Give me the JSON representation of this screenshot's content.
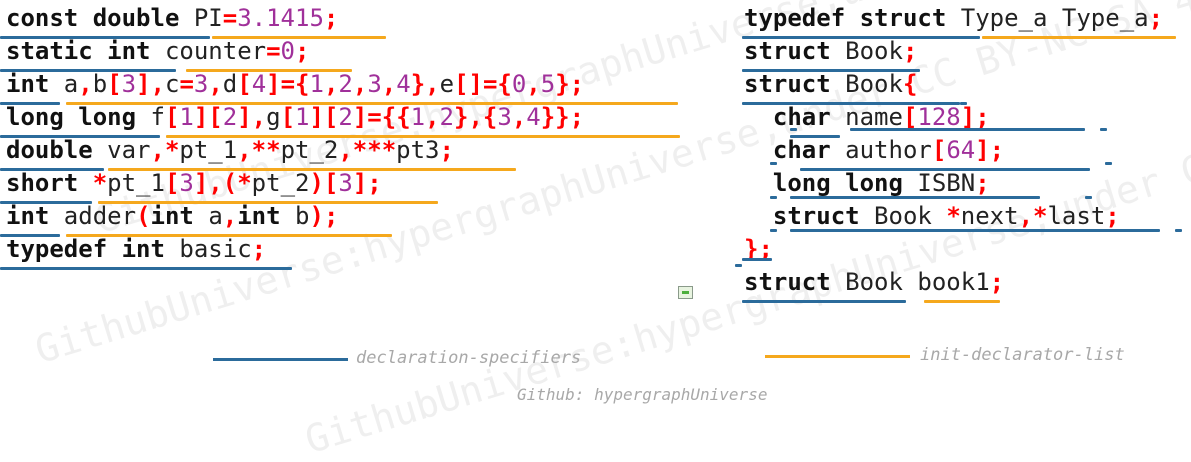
{
  "colors": {
    "keyword": "#111111",
    "identifier": "#222222",
    "punctuation": "#ff0000",
    "number": "#a0309a",
    "declaration_specifiers": "#2b6b9b",
    "init_declarator_list": "#f5a81d",
    "watermark": "#efefef",
    "caption": "#a8a8a8"
  },
  "watermark_text": "GithubUniverse:hypergraphUniverse,under CC BY-NC-SA 4.0",
  "left_code": [
    [
      [
        "k",
        "const double"
      ],
      [
        "t",
        " PI"
      ],
      [
        "p",
        "="
      ],
      [
        "n",
        "3.1415"
      ],
      [
        "p",
        ";"
      ]
    ],
    [
      [
        "k",
        "static int"
      ],
      [
        "t",
        " counter"
      ],
      [
        "p",
        "="
      ],
      [
        "n",
        "0"
      ],
      [
        "p",
        ";"
      ]
    ],
    [
      [
        "k",
        "int"
      ],
      [
        "t",
        " a"
      ],
      [
        "p",
        ","
      ],
      [
        "t",
        "b"
      ],
      [
        "p",
        "["
      ],
      [
        "n",
        "3"
      ],
      [
        "p",
        "],"
      ],
      [
        "t",
        "c"
      ],
      [
        "p",
        "="
      ],
      [
        "n",
        "3"
      ],
      [
        "p",
        ","
      ],
      [
        "t",
        "d"
      ],
      [
        "p",
        "["
      ],
      [
        "n",
        "4"
      ],
      [
        "p",
        "]={"
      ],
      [
        "n",
        "1"
      ],
      [
        "p",
        ","
      ],
      [
        "n",
        "2"
      ],
      [
        "p",
        ","
      ],
      [
        "n",
        "3"
      ],
      [
        "p",
        ","
      ],
      [
        "n",
        "4"
      ],
      [
        "p",
        "},"
      ],
      [
        "t",
        "e"
      ],
      [
        "p",
        "[]={"
      ],
      [
        "n",
        "0"
      ],
      [
        "p",
        ","
      ],
      [
        "n",
        "5"
      ],
      [
        "p",
        "};"
      ]
    ],
    [
      [
        "k",
        "long long"
      ],
      [
        "t",
        " f"
      ],
      [
        "p",
        "["
      ],
      [
        "n",
        "1"
      ],
      [
        "p",
        "]["
      ],
      [
        "n",
        "2"
      ],
      [
        "p",
        "],"
      ],
      [
        "t",
        "g"
      ],
      [
        "p",
        "["
      ],
      [
        "n",
        "1"
      ],
      [
        "p",
        "]["
      ],
      [
        "n",
        "2"
      ],
      [
        "p",
        "]={{"
      ],
      [
        "n",
        "1"
      ],
      [
        "p",
        ","
      ],
      [
        "n",
        "2"
      ],
      [
        "p",
        "},{"
      ],
      [
        "n",
        "3"
      ],
      [
        "p",
        ","
      ],
      [
        "n",
        "4"
      ],
      [
        "p",
        "}};"
      ]
    ],
    [
      [
        "k",
        "double"
      ],
      [
        "t",
        " var"
      ],
      [
        "p",
        ",*"
      ],
      [
        "t",
        "pt_1"
      ],
      [
        "p",
        ",**"
      ],
      [
        "t",
        "pt_2"
      ],
      [
        "p",
        ",***"
      ],
      [
        "t",
        "pt3"
      ],
      [
        "p",
        ";"
      ]
    ],
    [
      [
        "k",
        "short"
      ],
      [
        "t",
        " "
      ],
      [
        "p",
        "*"
      ],
      [
        "t",
        "pt_1"
      ],
      [
        "p",
        "["
      ],
      [
        "n",
        "3"
      ],
      [
        "p",
        "],("
      ],
      [
        "p",
        "*"
      ],
      [
        "t",
        "pt_2"
      ],
      [
        "p",
        ")["
      ],
      [
        "n",
        "3"
      ],
      [
        "p",
        "];"
      ]
    ],
    [
      [
        "k",
        "int"
      ],
      [
        "t",
        " adder"
      ],
      [
        "p",
        "("
      ],
      [
        "k",
        "int"
      ],
      [
        "t",
        " a"
      ],
      [
        "p",
        ","
      ],
      [
        "k",
        "int"
      ],
      [
        "t",
        " b"
      ],
      [
        "p",
        ");"
      ]
    ],
    [
      [
        "k",
        "typedef int"
      ],
      [
        "t",
        " basic"
      ],
      [
        "p",
        ";"
      ]
    ]
  ],
  "right_code": [
    [
      [
        "k",
        "typedef struct"
      ],
      [
        "t",
        " Type_a Type_a"
      ],
      [
        "p",
        ";"
      ]
    ],
    [
      [
        "k",
        "struct"
      ],
      [
        "t",
        " Book"
      ],
      [
        "p",
        ";"
      ]
    ],
    [
      [
        "k",
        "struct"
      ],
      [
        "t",
        " Book"
      ],
      [
        "p",
        "{"
      ]
    ],
    [
      [
        "t",
        "  "
      ],
      [
        "k",
        "char"
      ],
      [
        "t",
        " name"
      ],
      [
        "p",
        "["
      ],
      [
        "n",
        "128"
      ],
      [
        "p",
        "];"
      ]
    ],
    [
      [
        "t",
        "  "
      ],
      [
        "k",
        "char"
      ],
      [
        "t",
        " author"
      ],
      [
        "p",
        "["
      ],
      [
        "n",
        "64"
      ],
      [
        "p",
        "];"
      ]
    ],
    [
      [
        "t",
        "  "
      ],
      [
        "k",
        "long long"
      ],
      [
        "t",
        " ISBN"
      ],
      [
        "p",
        ";"
      ]
    ],
    [
      [
        "t",
        "  "
      ],
      [
        "k",
        "struct"
      ],
      [
        "t",
        " Book "
      ],
      [
        "p",
        "*"
      ],
      [
        "t",
        "next"
      ],
      [
        "p",
        ",*"
      ],
      [
        "t",
        "last"
      ],
      [
        "p",
        ";"
      ]
    ],
    [
      [
        "p",
        "};"
      ]
    ],
    [
      [
        "k",
        "struct"
      ],
      [
        "t",
        " Book book1"
      ],
      [
        "p",
        ";"
      ]
    ]
  ],
  "legend": {
    "declaration_specifiers": "declaration-specifiers",
    "init_declarator_list": "init-declarator-list"
  },
  "credit": "Github: hypergraphUniverse"
}
